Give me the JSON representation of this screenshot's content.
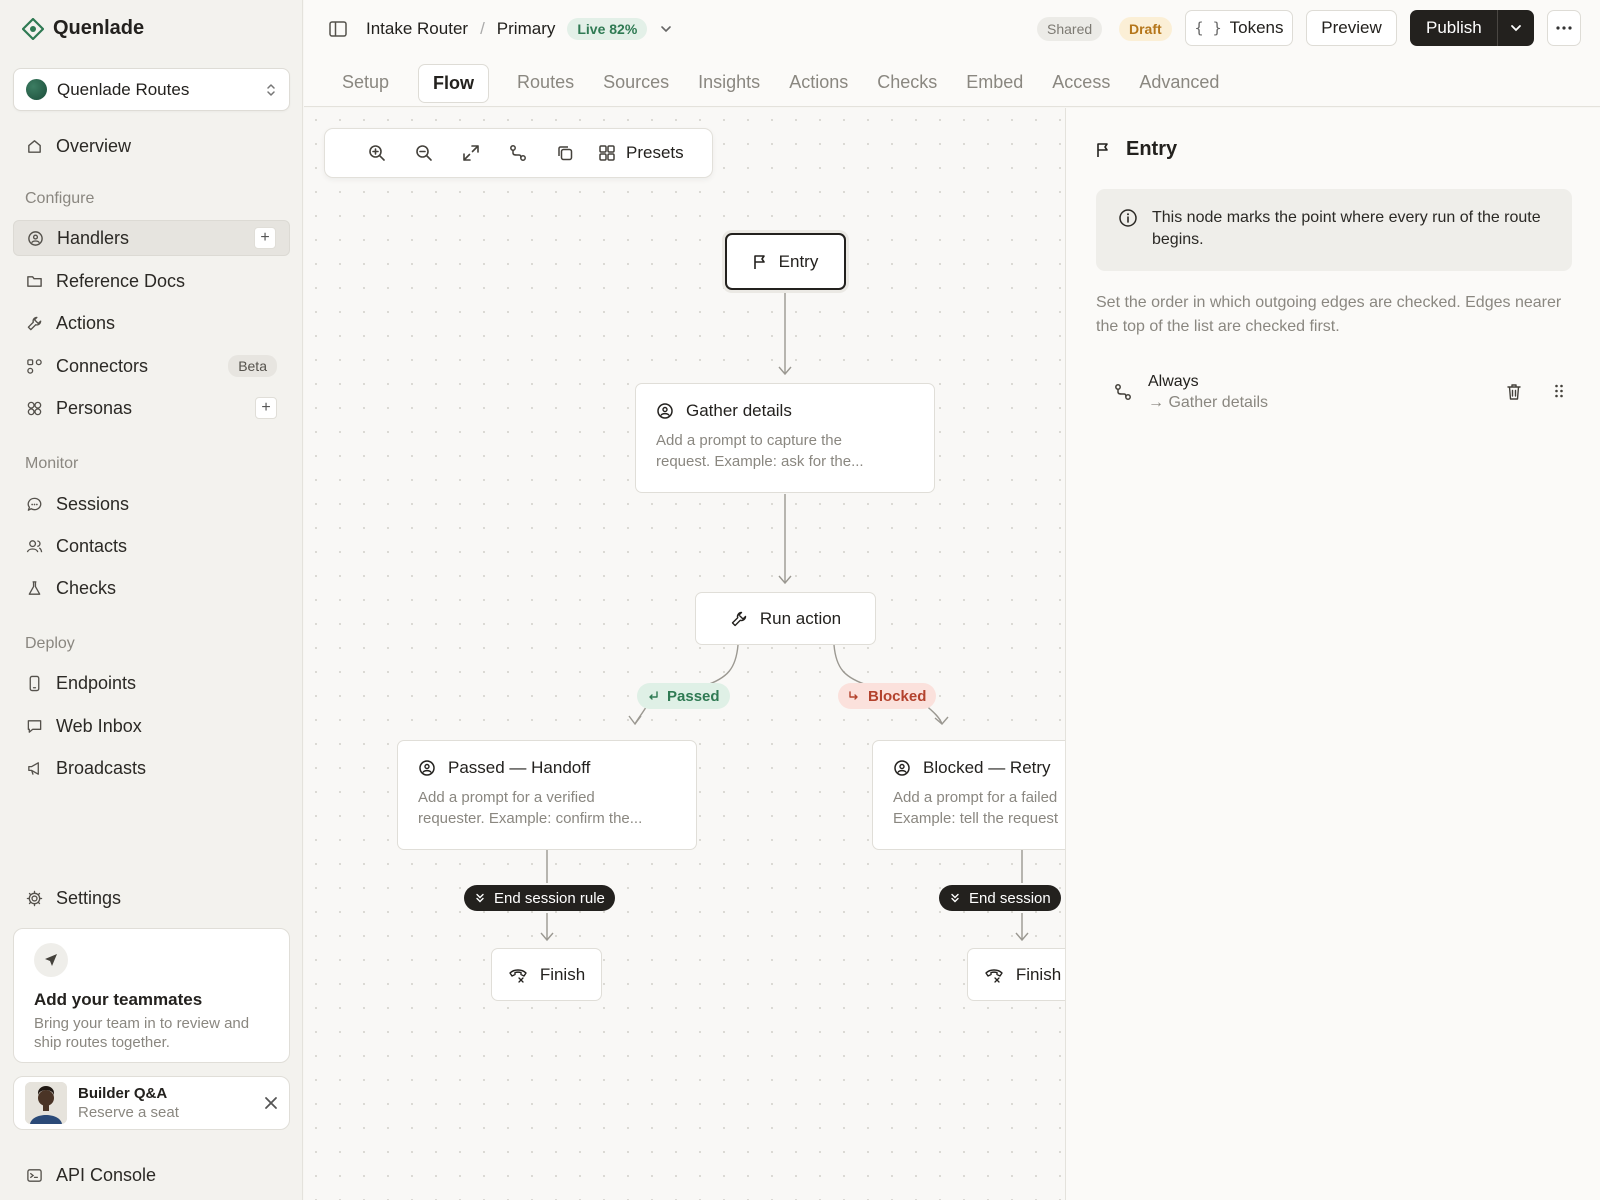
{
  "app": {
    "brand": "Quenlade"
  },
  "sidebar": {
    "workspace": "Quenlade Routes",
    "overview": "Overview",
    "sections": {
      "configure": "Configure",
      "monitor": "Monitor",
      "deploy": "Deploy"
    },
    "configure_items": [
      {
        "label": "Handlers",
        "icon": "handlers-icon",
        "active": true,
        "action": "+"
      },
      {
        "label": "Reference Docs",
        "icon": "folder-icon"
      },
      {
        "label": "Actions",
        "icon": "wrench-icon"
      },
      {
        "label": "Connectors",
        "icon": "connectors-icon",
        "badge": "Beta"
      },
      {
        "label": "Personas",
        "icon": "personas-icon",
        "action": "+"
      }
    ],
    "monitor_items": [
      {
        "label": "Sessions",
        "icon": "chat-bubble-icon"
      },
      {
        "label": "Contacts",
        "icon": "users-icon"
      },
      {
        "label": "Checks",
        "icon": "flask-icon"
      }
    ],
    "deploy_items": [
      {
        "label": "Endpoints",
        "icon": "phone-icon"
      },
      {
        "label": "Web Inbox",
        "icon": "message-square-icon"
      },
      {
        "label": "Broadcasts",
        "icon": "megaphone-icon"
      }
    ],
    "settings": "Settings",
    "invite": {
      "title": "Add your teammates",
      "desc": "Bring your team in to review and ship routes together."
    },
    "event": {
      "title": "Builder Q&A",
      "subtitle": "Reserve a seat"
    },
    "api_console": "API Console"
  },
  "topbar": {
    "breadcrumb": [
      "Intake Router",
      "Primary"
    ],
    "live_badge": "Live 82%",
    "shared": "Shared",
    "draft": "Draft",
    "tokens": "Tokens",
    "preview": "Preview",
    "publish": "Publish",
    "tabs": [
      "Setup",
      "Flow",
      "Routes",
      "Sources",
      "Insights",
      "Actions",
      "Checks",
      "Embed",
      "Access",
      "Advanced"
    ],
    "active_tab": "Flow"
  },
  "canvas": {
    "presets": "Presets",
    "nodes": {
      "entry": "Entry",
      "gather": {
        "title": "Gather details",
        "desc1": "Add a prompt to capture the",
        "desc2": "request. Example: ask for the..."
      },
      "run": "Run action",
      "passed_label": "Passed",
      "blocked_label": "Blocked",
      "handoff": {
        "title": "Passed — Handoff",
        "desc1": "Add a prompt for a verified",
        "desc2": "requester. Example: confirm the..."
      },
      "retry": {
        "title": "Blocked — Retry",
        "desc1": "Add a prompt for a failed",
        "desc2": "Example: tell the request"
      },
      "end_rule_1": "End session rule",
      "end_rule_2": "End session",
      "finish": "Finish"
    }
  },
  "panel": {
    "title": "Entry",
    "info": "This node marks the point where every run of the route begins.",
    "help": "Set the order in which outgoing edges are checked. Edges nearer the top of the list are checked first.",
    "edge": {
      "label": "Always",
      "target": "→ Gather details"
    }
  },
  "colors": {
    "accent_dark": "#23211e",
    "live_green": "#2f7a53",
    "draft_amber": "#b5761a",
    "blocked_red": "#b3422d"
  }
}
